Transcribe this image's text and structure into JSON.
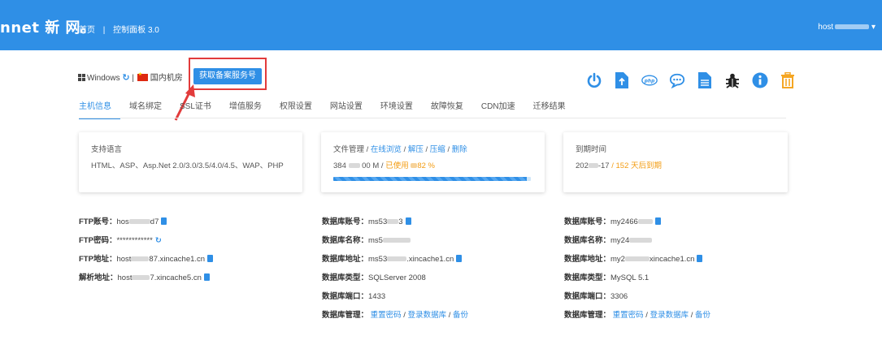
{
  "header": {
    "logo": "nnet 新 网。",
    "nav": [
      "首页",
      "控制面板 3.0"
    ],
    "nav_sep": "|",
    "user": "host"
  },
  "info": {
    "os": "Windows",
    "sep": "|",
    "region": "国内机房",
    "get_button": "获取备案服务号"
  },
  "actions": [
    {
      "icon": "power-icon",
      "color": "#2f8fe6"
    },
    {
      "icon": "file-upload-icon",
      "color": "#2f8fe6"
    },
    {
      "icon": "php-icon",
      "color": "#2f8fe6"
    },
    {
      "icon": "chat-icon",
      "color": "#2f8fe6"
    },
    {
      "icon": "document-icon",
      "color": "#2f8fe6"
    },
    {
      "icon": "bug-icon",
      "color": "#222222"
    },
    {
      "icon": "info-icon",
      "color": "#2f8fe6"
    },
    {
      "icon": "trash-icon",
      "color": "#f5a623"
    }
  ],
  "tabs": [
    "主机信息",
    "域名绑定",
    "SSL证书",
    "增值服务",
    "权限设置",
    "网站设置",
    "环境设置",
    "故障恢复",
    "CDN加速",
    "迁移结果"
  ],
  "cards": {
    "lang": {
      "title": "支持语言",
      "body": "HTML、ASP、Asp.Net 2.0/3.0/3.5/4.0/4.5、WAP、PHP"
    },
    "files": {
      "title": "文件管理 / ",
      "links": [
        "在线浏览",
        "解压",
        "压缩",
        "删除"
      ],
      "link_sep": " / ",
      "used": "384",
      "total": "00 M / ",
      "used_label": "已使用",
      "percent_text": "82 %",
      "progress": 0.98
    },
    "expire": {
      "title": "到期时间",
      "date_prefix": "202",
      "date_suffix": "-17",
      "remaining": " / 152 天后到期"
    }
  },
  "ftp": [
    {
      "label": "FTP账号：",
      "value": "hos",
      "value2": "d7",
      "extra": "copy"
    },
    {
      "label": "FTP密码：",
      "value": "************",
      "value2": "",
      "extra": "refresh"
    },
    {
      "label": "FTP地址：",
      "value": "host",
      "value2": "87.xincache1.cn",
      "extra": "copy"
    },
    {
      "label": "解析地址：",
      "value": "host",
      "value2": "7.xincache5.cn",
      "extra": "copy"
    }
  ],
  "db1": [
    {
      "label": "数据库账号：",
      "value": "ms53",
      "value2": "3",
      "extra": "copy"
    },
    {
      "label": "数据库名称：",
      "value": "ms5",
      "value2": "",
      "extra": ""
    },
    {
      "label": "数据库地址：",
      "value": "ms53",
      "value2": ".xincache1.cn",
      "extra": "copy"
    },
    {
      "label": "数据库类型：",
      "value": "SQLServer 2008",
      "value2": "",
      "extra": ""
    },
    {
      "label": "数据库端口：",
      "value": "1433",
      "value2": "",
      "extra": ""
    },
    {
      "label": "数据库管理：",
      "links": [
        "重置密码",
        "登录数据库",
        "备份"
      ]
    }
  ],
  "db2": [
    {
      "label": "数据库账号：",
      "value": "my2466",
      "value2": "",
      "extra": "copy"
    },
    {
      "label": "数据库名称：",
      "value": "my24",
      "value2": "",
      "extra": ""
    },
    {
      "label": "数据库地址：",
      "value": "my2",
      "value2": "xincache1.cn",
      "extra": "copy"
    },
    {
      "label": "数据库类型：",
      "value": "MySQL 5.1",
      "value2": "",
      "extra": ""
    },
    {
      "label": "数据库端口：",
      "value": "3306",
      "value2": "",
      "extra": ""
    },
    {
      "label": "数据库管理：",
      "links": [
        "重置密码",
        "登录数据库",
        "备份"
      ]
    }
  ]
}
